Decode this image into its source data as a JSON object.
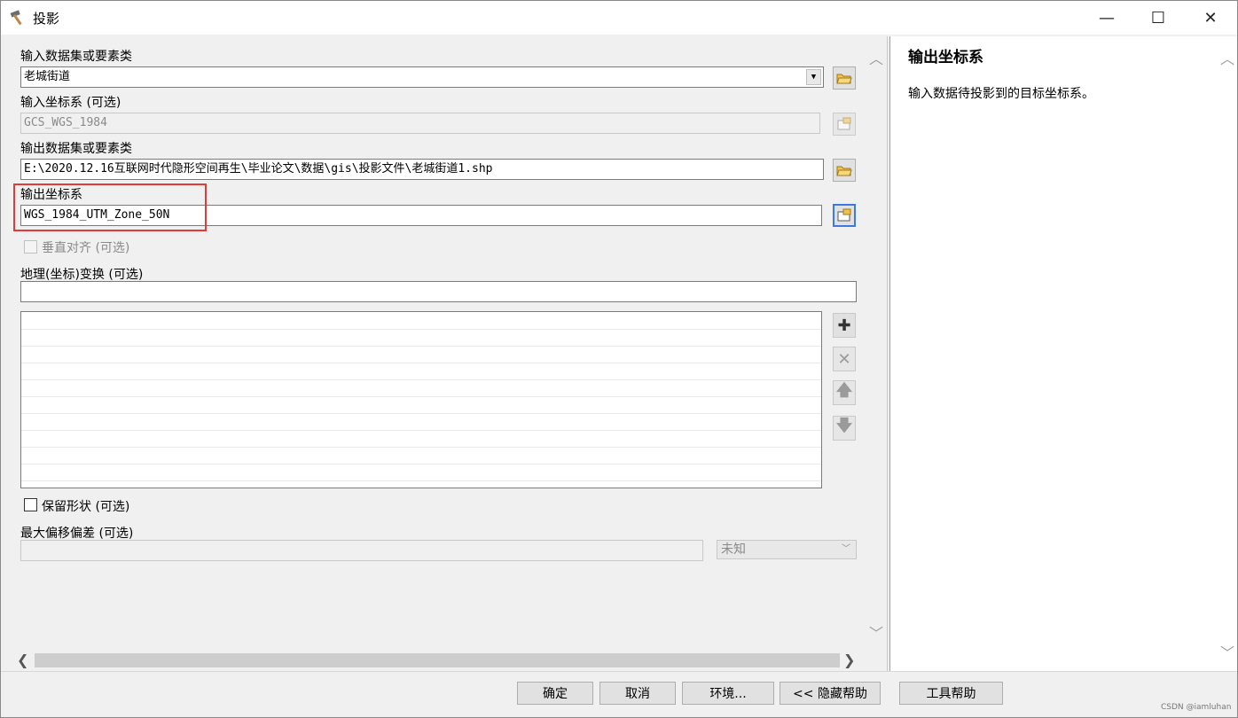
{
  "window": {
    "title": "投影"
  },
  "window_controls": {
    "minimize": "—",
    "maximize": "☐",
    "close": "✕"
  },
  "form": {
    "input_dataset": {
      "label": "输入数据集或要素类",
      "value": "老城街道"
    },
    "input_cs": {
      "label": "输入坐标系 (可选)",
      "value": "GCS_WGS_1984"
    },
    "output_dataset": {
      "label": "输出数据集或要素类",
      "value": "E:\\2020.12.16互联网时代隐形空间再生\\毕业论文\\数据\\gis\\投影文件\\老城街道1.shp"
    },
    "output_cs": {
      "label": "输出坐标系",
      "value": "WGS_1984_UTM_Zone_50N"
    },
    "vertical": {
      "label": "垂直对齐 (可选)"
    },
    "geo_transform": {
      "label": "地理(坐标)变换 (可选)",
      "value": ""
    },
    "preserve_shape": {
      "label": "保留形状 (可选)"
    },
    "max_offset": {
      "label": "最大偏移偏差 (可选)",
      "value": "",
      "unit": "未知"
    }
  },
  "side_buttons": {
    "add": "✚",
    "remove": "✕",
    "up": "🡅",
    "down": "🡇"
  },
  "scroll_glyphs": {
    "up": "︿",
    "down": "﹀",
    "left": "❮",
    "right": "❯"
  },
  "combo_arrow": "▼",
  "help": {
    "title": "输出坐标系",
    "text": "输入数据待投影到的目标坐标系。"
  },
  "buttons": {
    "ok": "确定",
    "cancel": "取消",
    "env": "环境...",
    "hide_help": "<< 隐藏帮助",
    "tool_help": "工具帮助"
  },
  "watermark": "CSDN @iamluhan",
  "colors": {
    "highlight": "#e53935",
    "focus": "#3d7ae0"
  }
}
